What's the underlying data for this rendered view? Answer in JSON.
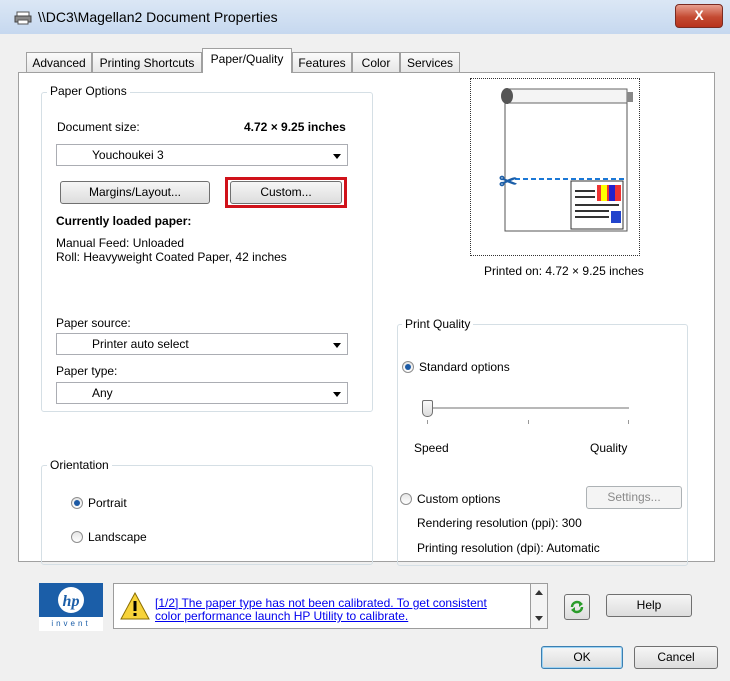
{
  "window": {
    "title": "\\\\DC3\\Magellan2 Document Properties",
    "close_label": "X"
  },
  "tabs": [
    {
      "label": "Advanced"
    },
    {
      "label": "Printing Shortcuts"
    },
    {
      "label": "Paper/Quality"
    },
    {
      "label": "Features"
    },
    {
      "label": "Color"
    },
    {
      "label": "Services"
    }
  ],
  "paper_options": {
    "group_label": "Paper Options",
    "document_size_label": "Document size:",
    "document_size_value": "4.72 × 9.25 inches",
    "size_combo_value": "Youchoukei 3",
    "margins_button": "Margins/Layout...",
    "custom_button": "Custom...",
    "loaded_heading": "Currently loaded paper:",
    "manual_feed": "Manual Feed: Unloaded",
    "roll": "Roll:  Heavyweight Coated Paper, 42 inches",
    "paper_source_label": "Paper source:",
    "paper_source_value": "Printer auto select",
    "paper_type_label": "Paper type:",
    "paper_type_value": "Any"
  },
  "preview": {
    "printed_on": "Printed on: 4.72 × 9.25 inches"
  },
  "orientation": {
    "group_label": "Orientation",
    "portrait": "Portrait",
    "landscape": "Landscape",
    "selected": "portrait"
  },
  "print_quality": {
    "group_label": "Print Quality",
    "standard_label": "Standard options",
    "speed_label": "Speed",
    "quality_label": "Quality",
    "slider_level": 0,
    "custom_label": "Custom options",
    "settings_button": "Settings...",
    "rendering": "Rendering resolution (ppi): 300",
    "printing": "Printing resolution (dpi): Automatic",
    "selected": "standard"
  },
  "footer": {
    "logo_text": "invent",
    "warning_line1": "[1/2] The paper type has not been calibrated. To get consistent",
    "warning_line2": "color performance launch HP Utility to calibrate.",
    "help_button": "Help",
    "ok_button": "OK",
    "cancel_button": "Cancel"
  },
  "colors": {
    "highlight_red": "#d0121a",
    "link_blue": "#0000ee",
    "hp_blue": "#1b5ea8"
  }
}
